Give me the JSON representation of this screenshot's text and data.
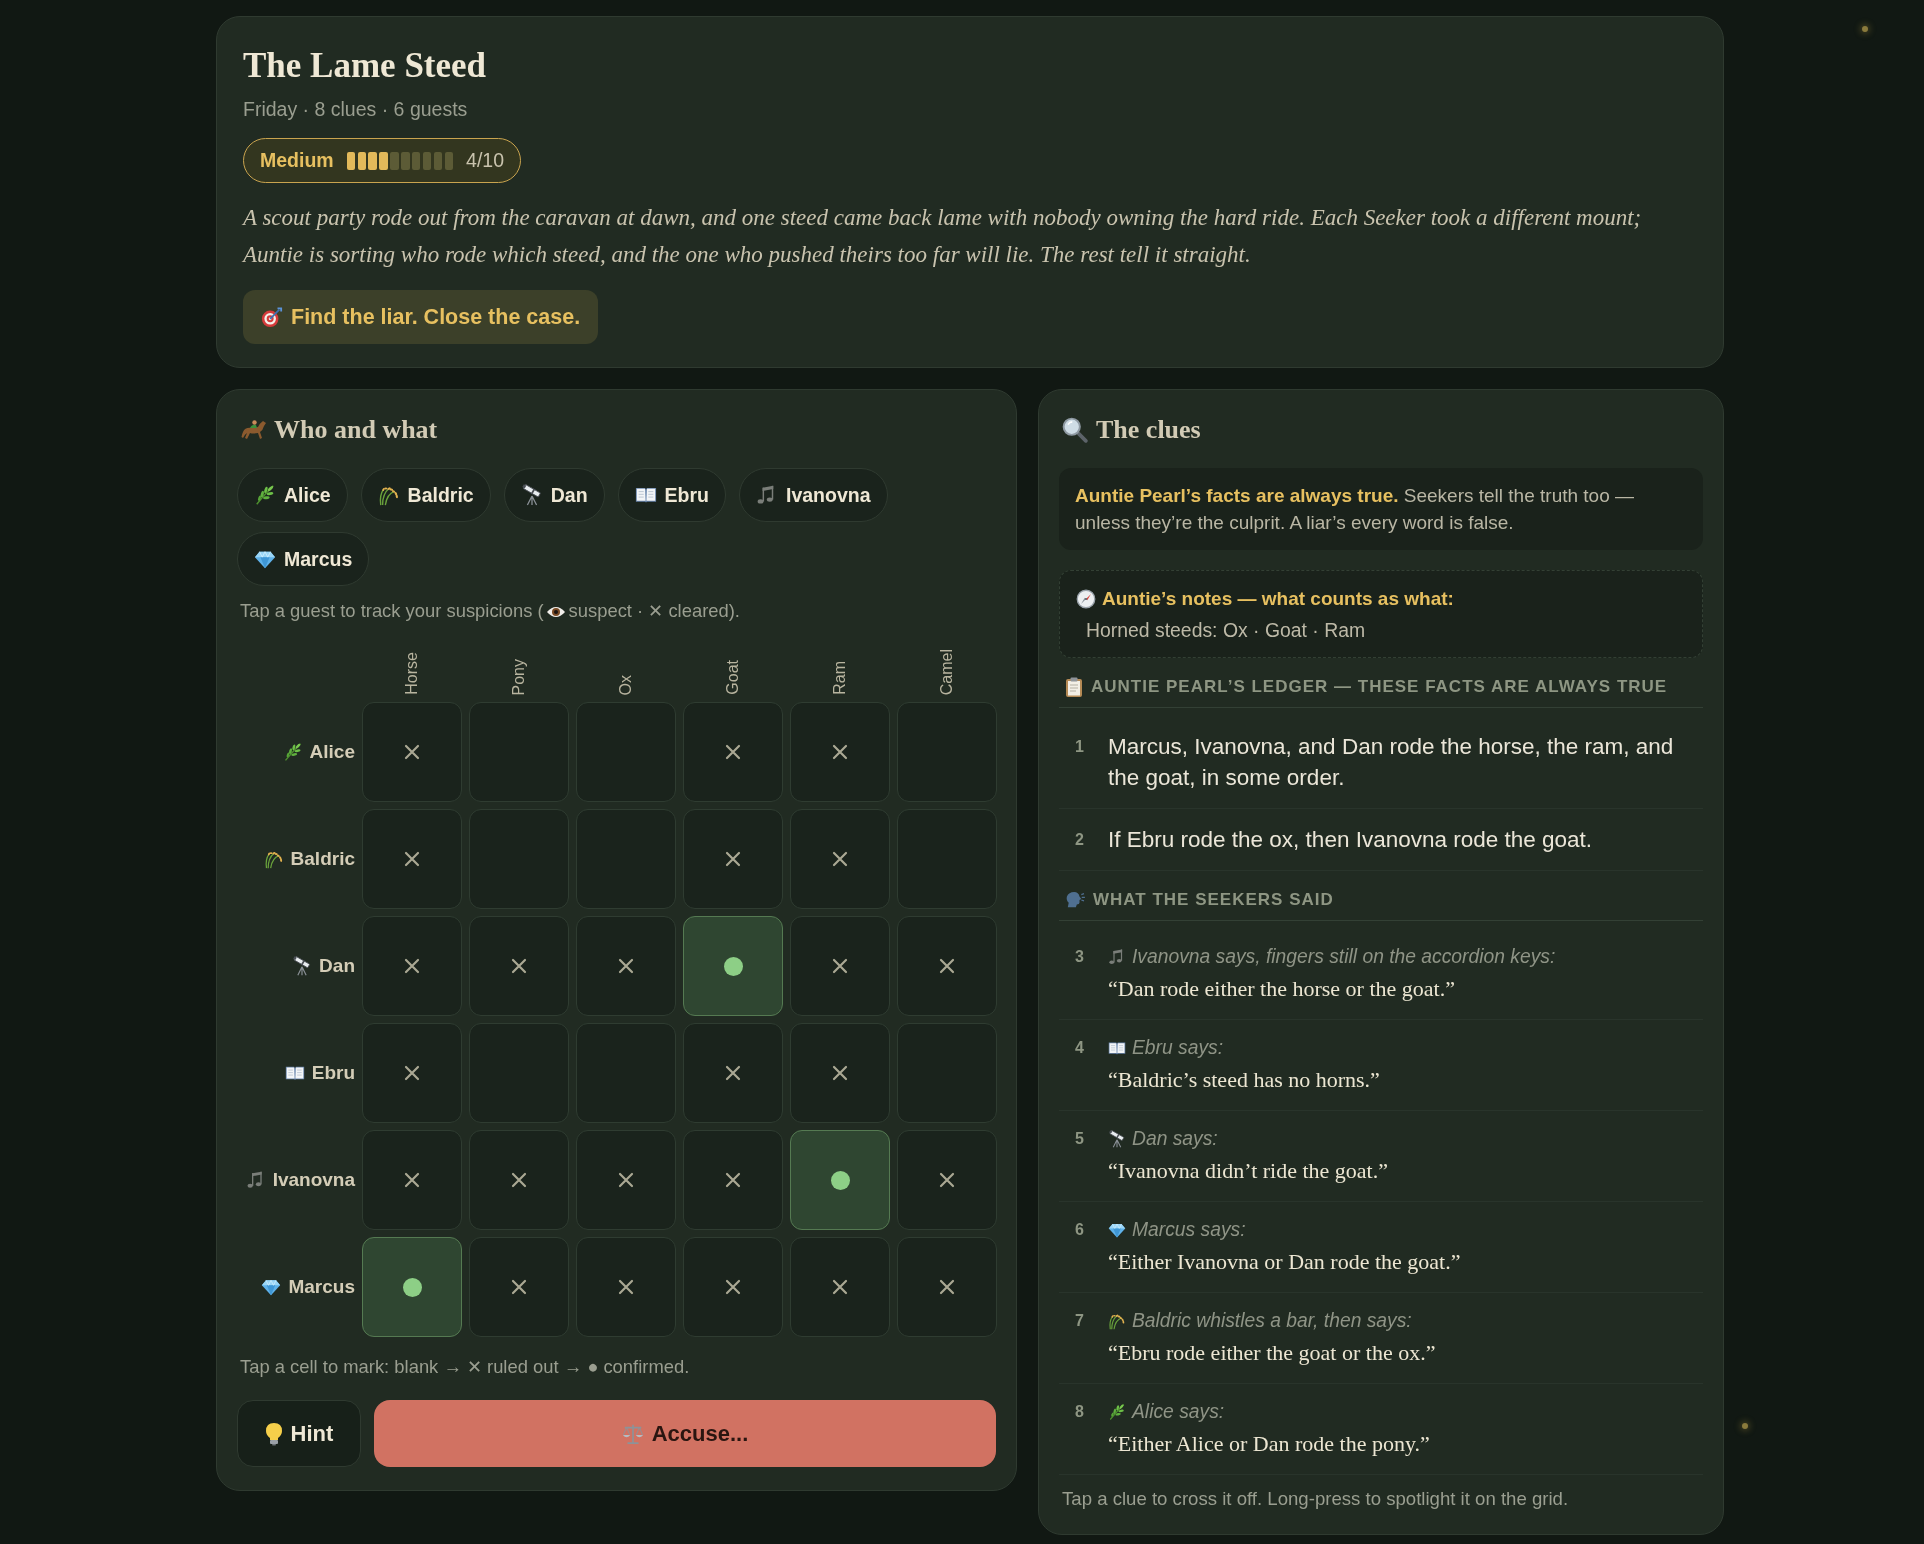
{
  "header": {
    "title": "The Lame Steed",
    "meta": "Friday · 8 clues · 6 guests",
    "difficulty": {
      "label": "Medium",
      "level": 0.4,
      "reading": "4/10"
    },
    "story": "A scout party rode out from the caravan at dawn, and one steed came back lame with nobody owning the hard ride. Each Seeker took a different mount; Auntie is sorting who rode which steed, and the one who pushed theirs too far will lie. The rest tell it straight.",
    "goal": "Find the liar. Close the case."
  },
  "grid_panel": {
    "title": "Who and what",
    "guests": [
      {
        "name": "Alice"
      },
      {
        "name": "Baldric"
      },
      {
        "name": "Dan"
      },
      {
        "name": "Ebru"
      },
      {
        "name": "Ivanovna"
      },
      {
        "name": "Marcus"
      }
    ],
    "guest_hint": {
      "before": "Tap a guest to track your suspicions (",
      "after": "suspect · ✕ cleared)."
    },
    "columns": [
      "Horse",
      "Pony",
      "Ox",
      "Goat",
      "Ram",
      "Camel"
    ],
    "rows": [
      {
        "guest": "Alice",
        "cells": [
          {
            "ruled_out": true,
            "confirmed": false
          },
          {
            "ruled_out": false,
            "confirmed": false
          },
          {
            "ruled_out": false,
            "confirmed": false
          },
          {
            "ruled_out": true,
            "confirmed": false
          },
          {
            "ruled_out": true,
            "confirmed": false
          },
          {
            "ruled_out": false,
            "confirmed": false
          }
        ]
      },
      {
        "guest": "Baldric",
        "cells": [
          {
            "ruled_out": true,
            "confirmed": false
          },
          {
            "ruled_out": false,
            "confirmed": false
          },
          {
            "ruled_out": false,
            "confirmed": false
          },
          {
            "ruled_out": true,
            "confirmed": false
          },
          {
            "ruled_out": true,
            "confirmed": false
          },
          {
            "ruled_out": false,
            "confirmed": false
          }
        ]
      },
      {
        "guest": "Dan",
        "cells": [
          {
            "ruled_out": true,
            "confirmed": false
          },
          {
            "ruled_out": true,
            "confirmed": false
          },
          {
            "ruled_out": true,
            "confirmed": false
          },
          {
            "ruled_out": false,
            "confirmed": true
          },
          {
            "ruled_out": true,
            "confirmed": false
          },
          {
            "ruled_out": true,
            "confirmed": false
          }
        ]
      },
      {
        "guest": "Ebru",
        "cells": [
          {
            "ruled_out": true,
            "confirmed": false
          },
          {
            "ruled_out": false,
            "confirmed": false
          },
          {
            "ruled_out": false,
            "confirmed": false
          },
          {
            "ruled_out": true,
            "confirmed": false
          },
          {
            "ruled_out": true,
            "confirmed": false
          },
          {
            "ruled_out": false,
            "confirmed": false
          }
        ]
      },
      {
        "guest": "Ivanovna",
        "cells": [
          {
            "ruled_out": true,
            "confirmed": false
          },
          {
            "ruled_out": true,
            "confirmed": false
          },
          {
            "ruled_out": true,
            "confirmed": false
          },
          {
            "ruled_out": true,
            "confirmed": false
          },
          {
            "ruled_out": false,
            "confirmed": true
          },
          {
            "ruled_out": true,
            "confirmed": false
          }
        ]
      },
      {
        "guest": "Marcus",
        "cells": [
          {
            "ruled_out": false,
            "confirmed": true
          },
          {
            "ruled_out": true,
            "confirmed": false
          },
          {
            "ruled_out": true,
            "confirmed": false
          },
          {
            "ruled_out": true,
            "confirmed": false
          },
          {
            "ruled_out": true,
            "confirmed": false
          },
          {
            "ruled_out": true,
            "confirmed": false
          }
        ]
      }
    ],
    "cell_hint": "Tap a cell to mark: blank → ✕ ruled out → ● confirmed.",
    "buttons": [
      {
        "label": "Hint",
        "kind": "secondary"
      },
      {
        "label": "Accuse...",
        "kind": "primary"
      }
    ]
  },
  "clues_panel": {
    "title": "The clues",
    "rules": "**Auntie Pearl’s facts are always true.** Seekers tell the truth too — unless they’re the culprit. A liar’s every word is false.",
    "notes": {
      "title": "Auntie’s notes — what counts as what:",
      "body": "Horned steeds: Ox · Goat · Ram"
    },
    "sections": [
      {
        "kind": "ledger",
        "heading": "AUNTIE PEARL’S LEDGER — THESE FACTS ARE ALWAYS TRUE",
        "clues": [
          {
            "number": "1",
            "text": "Marcus, Ivanovna, and Dan rode the horse, the ram, and the goat, in some order."
          },
          {
            "number": "2",
            "text": "If Ebru rode the ox, then Ivanovna rode the goat."
          }
        ]
      },
      {
        "kind": "statements",
        "heading": "WHAT THE SEEKERS SAID",
        "clues": [
          {
            "number": "3",
            "speaker": "Ivanovna says, fingers still on the accordion keys:",
            "quote": "“Dan rode either the horse or the goat.”"
          },
          {
            "number": "4",
            "speaker": "Ebru says:",
            "quote": "“Baldric’s steed has no horns.”"
          },
          {
            "number": "5",
            "speaker": "Dan says:",
            "quote": "“Ivanovna didn’t ride the goat.”"
          },
          {
            "number": "6",
            "speaker": "Marcus says:",
            "quote": "“Either Ivanovna or Dan rode the goat.”"
          },
          {
            "number": "7",
            "speaker": "Baldric whistles a bar, then says:",
            "quote": "“Ebru rode either the goat or the ox.”"
          },
          {
            "number": "8",
            "speaker": "Alice says:",
            "quote": "“Either Alice or Dan rode the pony.”"
          }
        ]
      }
    ],
    "footer": "Tap a clue to cross it off. Long-press to spotlight it on the grid."
  }
}
